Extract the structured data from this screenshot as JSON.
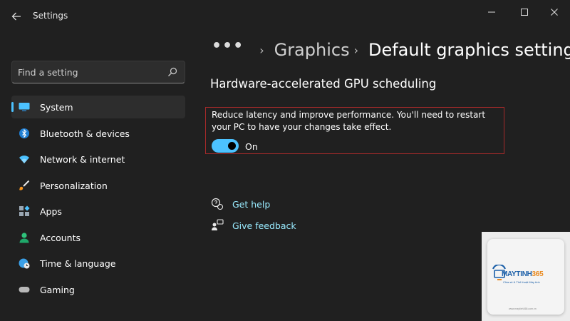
{
  "window": {
    "title": "Settings",
    "controls": [
      "minimize-icon",
      "maximize-icon",
      "close-icon"
    ]
  },
  "search": {
    "placeholder": "Find a setting"
  },
  "sidebar": {
    "items": [
      {
        "label": "System",
        "icon": "monitor-icon",
        "active": true
      },
      {
        "label": "Bluetooth & devices",
        "icon": "bluetooth-icon"
      },
      {
        "label": "Network & internet",
        "icon": "wifi-icon"
      },
      {
        "label": "Personalization",
        "icon": "brush-icon"
      },
      {
        "label": "Apps",
        "icon": "apps-icon"
      },
      {
        "label": "Accounts",
        "icon": "person-icon"
      },
      {
        "label": "Time & language",
        "icon": "globe-clock-icon"
      },
      {
        "label": "Gaming",
        "icon": "gamepad-icon"
      }
    ]
  },
  "breadcrumb": {
    "more": "•••",
    "parent": "Graphics",
    "current": "Default graphics settings",
    "separator": "›"
  },
  "section": {
    "title": "Hardware-accelerated GPU scheduling",
    "description": "Reduce latency and improve performance. You'll need to restart your PC to have your changes take effect.",
    "toggle_state": "On",
    "toggle_on": true
  },
  "links": {
    "help": "Get help",
    "feedback": "Give feedback"
  },
  "watermark": {
    "brand_main": "MAYTINH",
    "brand_accent": "365",
    "tagline": "Chia sẻ & Thủ thuật Máy tính",
    "footer": "www.maytinh365.com.vn"
  },
  "colors": {
    "background": "#202020",
    "accent": "#4cc2ff",
    "link": "#99ebff",
    "highlight_border": "#a52a2a"
  }
}
